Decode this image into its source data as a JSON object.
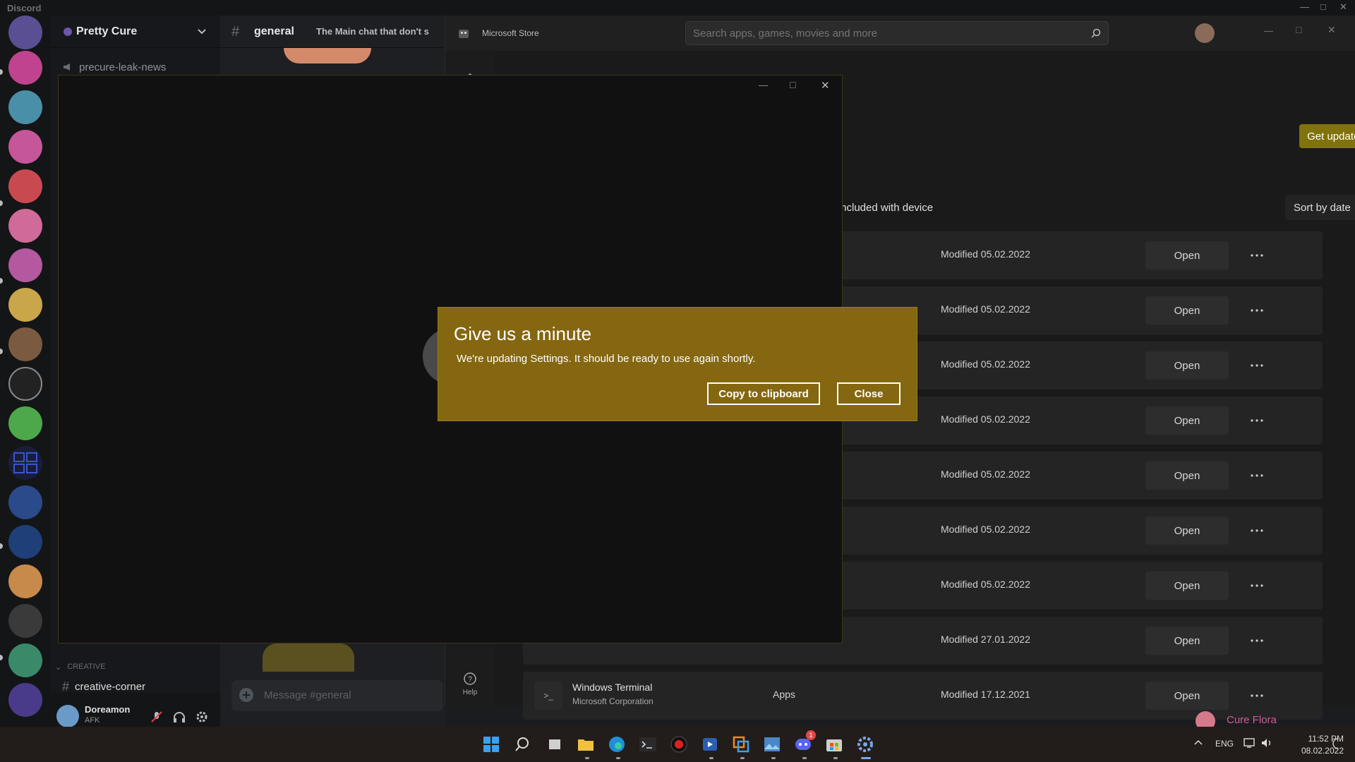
{
  "discord": {
    "app_title": "Discord",
    "server_name": "Pretty Cure",
    "channels": {
      "leak": "precure-leak-news",
      "category": "CREATIVE",
      "creative": "creative-corner"
    },
    "chat": {
      "channel": "general",
      "topic": "The Main chat that don't s",
      "composer_placeholder": "Message #general"
    },
    "user": {
      "name": "Doreamon",
      "status": "AFK"
    },
    "member_preview": "Cure Flora"
  },
  "store": {
    "title": "Microsoft Store",
    "search_placeholder": "Search apps, games, movies and more",
    "help_label": "Help",
    "get_updates": "Get updates",
    "filter_label": "Included with device",
    "sort_label": "Sort by date",
    "rows": [
      {
        "name": "",
        "publisher": "",
        "type": "",
        "modified": "Modified 05.02.2022",
        "action": "Open"
      },
      {
        "name": "",
        "publisher": "",
        "type": "",
        "modified": "Modified 05.02.2022",
        "action": "Open"
      },
      {
        "name": "",
        "publisher": "",
        "type": "",
        "modified": "Modified 05.02.2022",
        "action": "Open"
      },
      {
        "name": "",
        "publisher": "",
        "type": "",
        "modified": "Modified 05.02.2022",
        "action": "Open"
      },
      {
        "name": "",
        "publisher": "",
        "type": "",
        "modified": "Modified 05.02.2022",
        "action": "Open"
      },
      {
        "name": "",
        "publisher": "",
        "type": "",
        "modified": "Modified 05.02.2022",
        "action": "Open"
      },
      {
        "name": "",
        "publisher": "",
        "type": "",
        "modified": "Modified 05.02.2022",
        "action": "Open"
      },
      {
        "name": "",
        "publisher": "",
        "type": "",
        "modified": "Modified 27.01.2022",
        "action": "Open"
      },
      {
        "name": "Windows Terminal",
        "publisher": "Microsoft Corporation",
        "type": "Apps",
        "modified": "Modified 17.12.2021",
        "action": "Open"
      }
    ]
  },
  "dialog": {
    "title": "Give us a minute",
    "message": "We're updating Settings. It should be ready to use again shortly.",
    "copy_button": "Copy to clipboard",
    "close_button": "Close"
  },
  "taskbar": {
    "language": "ENG",
    "time": "11:52 PM",
    "date": "08.02.2022",
    "discord_badge": "1"
  },
  "colors": {
    "dialog_bg": "#846710",
    "accent_button": "#80720c",
    "discord_rail": "#141517"
  }
}
